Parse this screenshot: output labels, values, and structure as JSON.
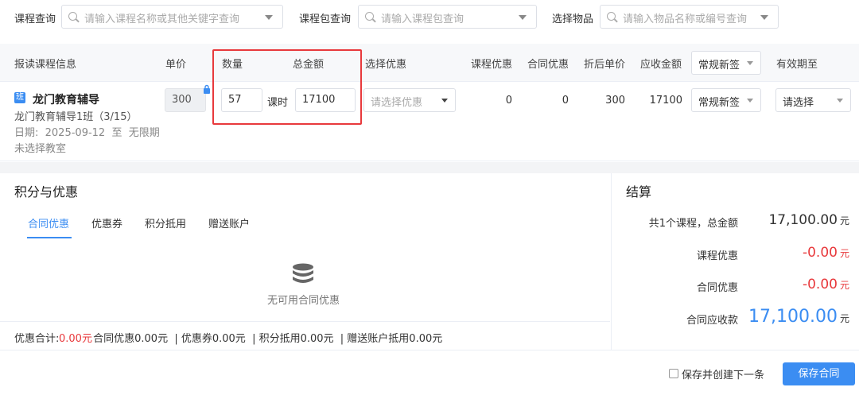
{
  "search": {
    "course_label": "课程查询",
    "course_placeholder": "请输入课程名称或其他关键字查询",
    "package_label": "课程包查询",
    "package_placeholder": "请输入课程包查询",
    "item_label": "选择物品",
    "item_placeholder": "请输入物品名称或编号查询"
  },
  "table": {
    "headers": {
      "course_info": "报读课程信息",
      "unit_price": "单价",
      "quantity": "数量",
      "total": "总金额",
      "discount_select": "选择优惠",
      "course_discount": "课程优惠",
      "contract_discount": "合同优惠",
      "discounted_price": "折后单价",
      "receivable": "应收金额",
      "sign_type": "常规新签",
      "valid_until": "有效期至"
    },
    "row": {
      "badge": "班",
      "course_name": "龙门教育辅导",
      "class_name": "龙门教育辅导1班（3/15）",
      "date": "日期:  2025-09-12  至  无限期",
      "room": "未选择教室",
      "unit_price": "300",
      "quantity": "57",
      "unit": "课时",
      "total": "17100",
      "discount_placeholder": "请选择优惠",
      "course_discount": "0",
      "contract_discount": "0",
      "discounted_price": "300",
      "receivable": "17100",
      "sign_type": "常规新签",
      "valid_until": "请选择"
    }
  },
  "points": {
    "title": "积分与优惠",
    "tabs": [
      "合同优惠",
      "优惠券",
      "积分抵用",
      "赠送账户"
    ],
    "empty_text": "无可用合同优惠",
    "summary_prefix": "优惠合计:",
    "summary_amount": "0.00元",
    "summary_rest": " 合同优惠0.00元  | 优惠券0.00元  | 积分抵用0.00元  | 赠送账户抵用0.00元"
  },
  "settlement": {
    "title": "结算",
    "rows": [
      {
        "label": "共1个课程，总金额",
        "value": "17,100.00",
        "unit": "元",
        "color": "#333333"
      },
      {
        "label": "课程优惠",
        "value": "-0.00",
        "unit": "元",
        "color": "#e8393c"
      },
      {
        "label": "合同优惠",
        "value": "-0.00",
        "unit": "元",
        "color": "#e8393c"
      },
      {
        "label": "合同应收款",
        "value": "17,100.00",
        "unit": "元",
        "color": "#3b8df2"
      }
    ]
  },
  "footer": {
    "checkbox_label": "保存并创建下一条",
    "save_label": "保存合同"
  },
  "colors": {
    "accent": "#3b8df2",
    "danger": "#e8393c"
  }
}
